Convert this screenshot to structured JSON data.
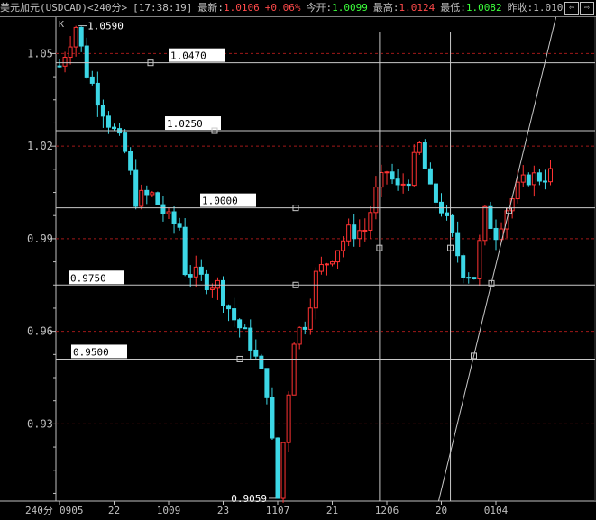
{
  "header": {
    "instrument": "美元加元(USDCAD)",
    "period": "<240分>",
    "time": "[17:38:19]",
    "last_label": "最新:",
    "last_value": "1.0106",
    "change": "+0.06%",
    "open_label": "今开:",
    "open_value": "1.0099",
    "high_label": "最高:",
    "high_value": "1.0124",
    "low_label": "最低:",
    "low_value": "1.0082",
    "prev_label": "昨收:",
    "prev_value": "1.0100",
    "nav_left": "⇦",
    "nav_right": "⇨"
  },
  "chart_data": {
    "type": "candlestick",
    "corner_marker": "K",
    "period_label": "240分",
    "y_ticks": [
      "1.05",
      "1.02",
      "0.99",
      "0.96",
      "0.93"
    ],
    "y_tick_values": [
      1.05,
      1.02,
      0.99,
      0.96,
      0.93
    ],
    "ylim": [
      0.905,
      1.0618
    ],
    "x_ticks": [
      "0905",
      "22",
      "1009",
      "23",
      "1107",
      "21",
      "1206",
      "20",
      "0104"
    ],
    "x_tick_index": [
      0,
      10,
      20,
      30,
      40,
      50,
      60,
      70,
      80
    ],
    "bar_count": 91,
    "annotations": {
      "max_label": "1.0590",
      "max_value": 1.059,
      "max_index": 3,
      "min_label": "0.9059",
      "min_value": 0.9059,
      "min_index": 40
    },
    "level_lines": [
      {
        "label": "1.0470",
        "value": 1.047
      },
      {
        "label": "1.0250",
        "value": 1.025
      },
      {
        "label": "1.0000",
        "value": 1.0
      },
      {
        "label": "0.9750",
        "value": 0.975
      },
      {
        "label": "0.9500",
        "value": 0.951
      }
    ],
    "vertical_markers_index": [
      58,
      71
    ],
    "trend_line": {
      "start": {
        "index": 69.5,
        "value": 0.905
      },
      "end": {
        "index": 91,
        "value": 1.0618
      }
    },
    "colors": {
      "up": "#ff3232",
      "down": "#3cd7e6",
      "axis": "#c0c0c0",
      "level": "#c8c8c8",
      "grid": "#a01818"
    },
    "keypoints": [
      [
        0,
        1.046
      ],
      [
        3,
        1.059
      ],
      [
        5,
        1.044
      ],
      [
        7,
        1.036
      ],
      [
        9,
        1.028
      ],
      [
        12,
        1.018
      ],
      [
        14,
        1.003
      ],
      [
        17,
        1.004
      ],
      [
        20,
        0.996
      ],
      [
        22,
        0.994
      ],
      [
        23,
        0.98
      ],
      [
        26,
        0.977
      ],
      [
        29,
        0.975
      ],
      [
        32,
        0.964
      ],
      [
        35,
        0.956
      ],
      [
        38,
        0.941
      ],
      [
        40,
        0.9059
      ],
      [
        41,
        0.924
      ],
      [
        43,
        0.958
      ],
      [
        45,
        0.963
      ],
      [
        47,
        0.978
      ],
      [
        50,
        0.985
      ],
      [
        53,
        0.992
      ],
      [
        56,
        0.993
      ],
      [
        58,
        1.005
      ],
      [
        60,
        1.012
      ],
      [
        62,
        1.006
      ],
      [
        64,
        1.01
      ],
      [
        66,
        1.02
      ],
      [
        68,
        1.005
      ],
      [
        70,
        1.0
      ],
      [
        72,
        0.99
      ],
      [
        74,
        0.98
      ],
      [
        76,
        0.978
      ],
      [
        78,
        0.998
      ],
      [
        80,
        0.992
      ],
      [
        82,
        1.0
      ],
      [
        84,
        1.006
      ],
      [
        86,
        1.01
      ],
      [
        88,
        1.01
      ],
      [
        90,
        1.011
      ]
    ]
  }
}
